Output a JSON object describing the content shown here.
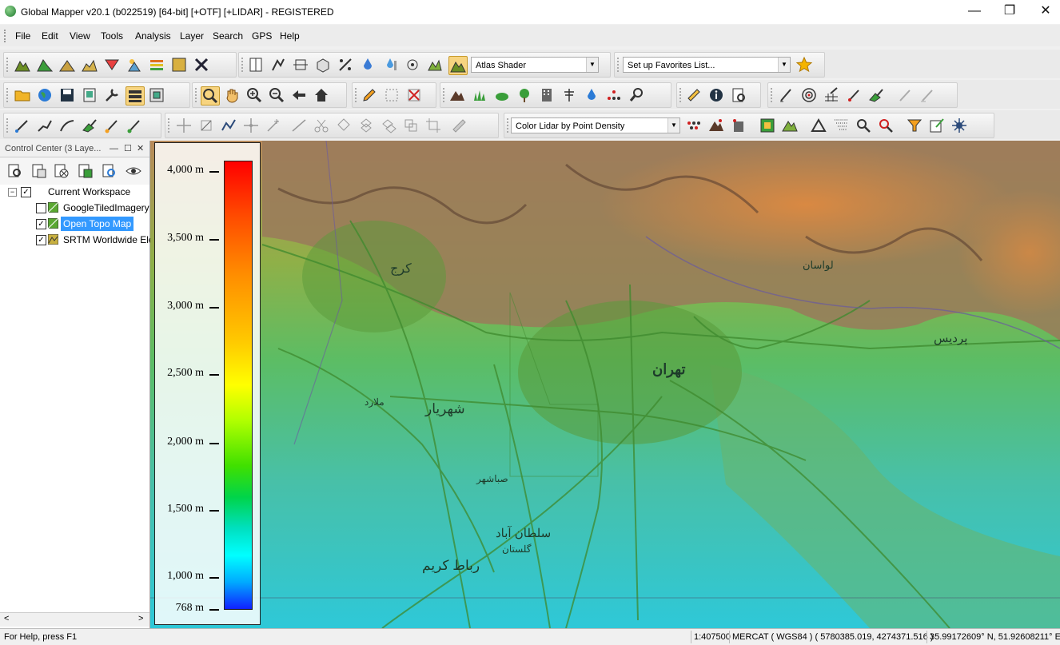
{
  "window": {
    "title": "Global Mapper v20.1 (b022519) [64-bit] [+OTF] [+LIDAR] - REGISTERED",
    "minimize_glyph": "—",
    "maximize_glyph": "❐",
    "close_glyph": "✕"
  },
  "menu": [
    "File",
    "Edit",
    "View",
    "Tools",
    "Analysis",
    "Layer",
    "Search",
    "GPS",
    "Help"
  ],
  "toolbar": {
    "shader_select": "Atlas Shader",
    "favorites_select": "Set up Favorites List...",
    "lidar_color_select": "Color Lidar by Point Density"
  },
  "control_center": {
    "title": "Control Center (3 Laye...",
    "minimize_glyph": "—",
    "restore_glyph": "☐",
    "close_glyph": "✕",
    "workspace_label": "Current Workspace",
    "layers": [
      {
        "name": "GoogleTiledImagery",
        "checked": false,
        "selected": false
      },
      {
        "name": "Open Topo Map",
        "checked": true,
        "selected": true
      },
      {
        "name": "SRTM Worldwide Ele",
        "checked": true,
        "selected": false
      }
    ],
    "scroll_left": "<",
    "scroll_right": ">"
  },
  "legend": {
    "labels": [
      "4,000 m",
      "3,500 m",
      "3,000 m",
      "2,500 m",
      "2,000 m",
      "1,500 m",
      "1,000 m",
      "768 m"
    ]
  },
  "map_labels": {
    "tehran": "تهران",
    "shahriar": "شهریار",
    "karaj": "کرج",
    "pardis": "پردیس",
    "lavasan": "لواسان",
    "robat_karim": "رباط کریم",
    "soltan_abad": "سلطان آباد",
    "sabashahr": "صباشهر",
    "golestan": "گلستان",
    "malard": "ملارد"
  },
  "status": {
    "help": "For Help, press F1",
    "scale": "1:407500",
    "projection": "MERCAT ( WGS84 ) ( 5780385.019, 4274371.516 )",
    "coords": "35.99172609° N, 51.92608211° E"
  },
  "colors": {
    "selection": "#3399ff",
    "active_tool": "#f7d480"
  }
}
